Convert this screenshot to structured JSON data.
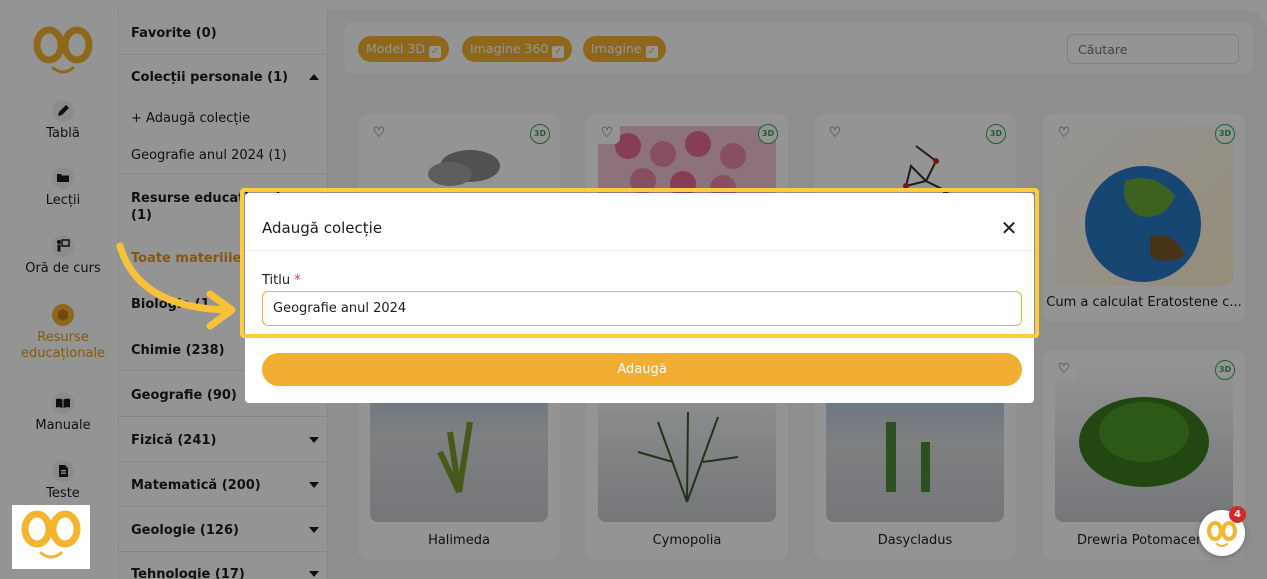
{
  "rail": {
    "items": [
      {
        "label": "Tablă",
        "icon": "pencil-icon"
      },
      {
        "label": "Lecții",
        "icon": "folder-icon"
      },
      {
        "label": "Oră de curs",
        "icon": "teacher-board-icon"
      },
      {
        "label": "Resurse educaționale",
        "icon": "cube-icon"
      },
      {
        "label": "Manuale",
        "icon": "book-icon"
      },
      {
        "label": "Teste",
        "icon": "file-icon"
      }
    ]
  },
  "sidebar": {
    "favorites": "Favorite (0)",
    "personal": "Colecții personale (1)",
    "add_collection": "+ Adaugă colecție",
    "collection_item": "Geografie anul 2024 (1)",
    "resources_line1": "Resurse educaționale",
    "resources_line2": "(1)",
    "all_materials": "Toate materiile (16",
    "biology": "Biologie (1",
    "chemistry": "Chimie (238)",
    "geography": "Geografie (90)",
    "physics": "Fizică (241)",
    "math": "Matematică (200)",
    "geology": "Geologie (126)",
    "technology": "Tehnologie (17)"
  },
  "filters": {
    "chips": [
      "Model 3D",
      "Imagine 360",
      "Imagine"
    ],
    "search_placeholder": "Căutare"
  },
  "cards": [
    {
      "caption": "Cum a calculat Eratostene c...",
      "badge": "3D"
    },
    {
      "caption": "Halimeda",
      "badge": "3D"
    },
    {
      "caption": "Cymopolia",
      "badge": "3D"
    },
    {
      "caption": "Dasycladus",
      "badge": "3D"
    },
    {
      "caption": "Drewria Potomacens",
      "badge": "3D"
    }
  ],
  "modal": {
    "title": "Adaugă colecție",
    "field_label": "Titlu",
    "required_mark": "*",
    "input_value": "Geografie anul 2024",
    "submit_label": "Adaugă"
  },
  "chat": {
    "badge_count": "4"
  },
  "colors": {
    "accent": "#f5b42d",
    "highlight": "#fbcc3b",
    "badge3d": "#2fa84f",
    "notification": "#d62828"
  }
}
